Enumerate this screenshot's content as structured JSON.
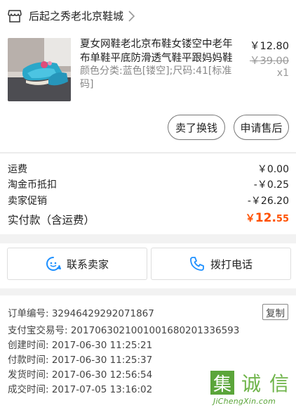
{
  "shop": {
    "name": "后起之秀老北京鞋城",
    "icon": "shop-icon"
  },
  "product": {
    "title": "夏女网鞋老北京布鞋女镂空中老年布单鞋平底防滑透气鞋平跟妈妈鞋",
    "spec": "颜色分类:蓝色[镂空];尺码:41[标准码]",
    "price": "￥12.80",
    "original_price": "￥39.00",
    "quantity": "x1"
  },
  "actions": {
    "resell": "卖了换钱",
    "after_sale": "申请售后"
  },
  "fees": [
    {
      "label": "运费",
      "value": "￥0.00"
    },
    {
      "label": "淘金币抵扣",
      "value": "-￥0.25"
    },
    {
      "label": "卖家促销",
      "value": "-￥26.20"
    }
  ],
  "total": {
    "label": "实付款（含运费）",
    "currency": "￥",
    "integer": "12.",
    "decimal": "55"
  },
  "contact": {
    "seller": "联系卖家",
    "call": "拨打电话"
  },
  "order": {
    "number": "订单编号: 32946429292071867",
    "copy": "复制",
    "rows": [
      "支付宝交易号: 2017063021001001680201336593",
      "创建时间: 2017-06-30 11:25:21",
      "付款时间: 2017-06-30 11:25:37",
      "发货时间: 2017-06-30 12:56:54",
      "成交时间: 2017-07-05 13:16:02"
    ]
  },
  "watermark": {
    "box_char": "集",
    "chars": [
      "诚",
      "信"
    ],
    "url": "JiChengXin.com"
  },
  "colors": {
    "accent": "#ff5000",
    "watermark_green": "#5ba53a"
  }
}
